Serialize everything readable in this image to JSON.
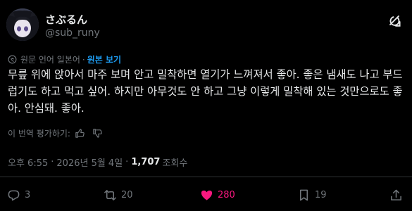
{
  "user": {
    "display_name": "さぶるん",
    "handle": "@sub_runy"
  },
  "translation": {
    "notice": "원문 언어 일본어",
    "separator": "·",
    "show_original": "원본 보기"
  },
  "post": {
    "text": "무릎 위에 앉아서 마주 보며 안고 밀착하면 열기가 느껴져서 좋아. 좋은 냄새도 나고 부드럽기도 하고 먹고 싶어. 하지만 아무것도 안 하고 그냥 이렇게 밀착해 있는 것만으로도 좋아. 안심돼. 좋아.",
    "time": "오후 6:55",
    "date": "2026년 5월 4일",
    "dot": "·",
    "views_count": "1,707",
    "views_label": "조회수"
  },
  "rate": {
    "label": "이 번역 평가하기:"
  },
  "actions": {
    "replies": "3",
    "reposts": "20",
    "likes": "280",
    "bookmarks": "19"
  },
  "colors": {
    "background": "#000000",
    "text": "#e7e9ea",
    "muted": "#71767b",
    "link": "#1d9bf0",
    "like": "#f91880"
  },
  "icons": [
    "grok-icon",
    "translate-icon",
    "thumbs-up-icon",
    "thumbs-down-icon",
    "reply-icon",
    "repost-icon",
    "heart-icon",
    "bookmark-icon",
    "share-icon"
  ]
}
